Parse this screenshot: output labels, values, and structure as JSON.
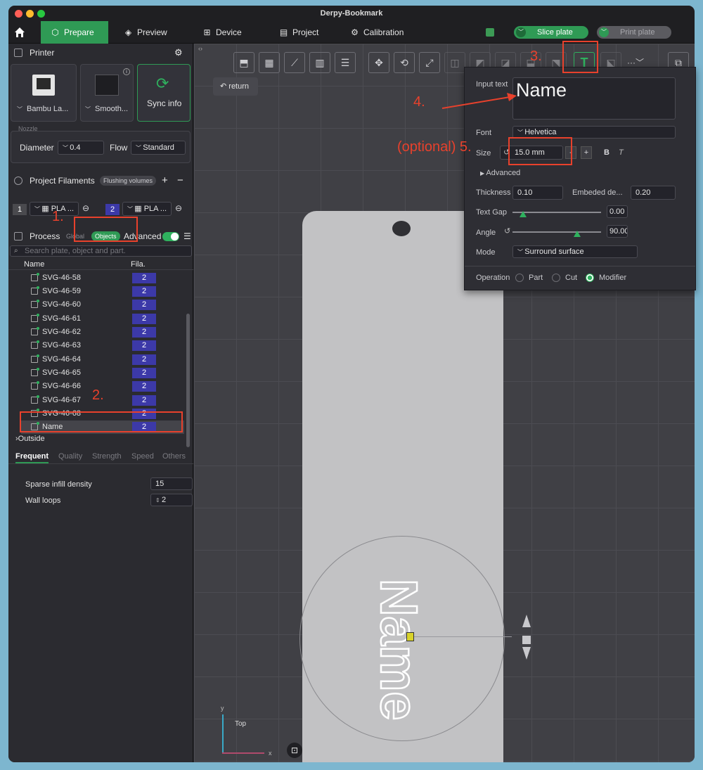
{
  "window": {
    "title": "Derpy-Bookmark"
  },
  "tabs": [
    {
      "label": "Prepare",
      "icon": "box-icon"
    },
    {
      "label": "Preview",
      "icon": "layers-icon"
    },
    {
      "label": "Device",
      "icon": "device-icon"
    },
    {
      "label": "Project",
      "icon": "project-icon"
    },
    {
      "label": "Calibration",
      "icon": "calibration-icon"
    }
  ],
  "actions": {
    "slice": "Slice plate",
    "print": "Print plate"
  },
  "printer": {
    "title": "Printer",
    "printer_name": "Bambu La...",
    "plate": "Smooth...",
    "sync": "Sync info",
    "nozzle_label": "Nozzle",
    "diameter_label": "Diameter",
    "diameter": "0.4",
    "flow_label": "Flow",
    "flow": "Standard"
  },
  "filaments": {
    "title": "Project Filaments",
    "flushing": "Flushing volumes",
    "items": [
      {
        "num": "1",
        "name": "PLA ...",
        "color": "#4a4a4e"
      },
      {
        "num": "2",
        "name": "PLA ...",
        "color": "#3c39a8"
      }
    ]
  },
  "process": {
    "title": "Process",
    "global": "Global",
    "objects": "Objects",
    "advanced": "Advanced",
    "search_placeholder": "Search plate, object and part.",
    "col_name": "Name",
    "col_fila": "Fila.",
    "rows": [
      {
        "name": "SVG-46-58",
        "fila": "2"
      },
      {
        "name": "SVG-46-59",
        "fila": "2"
      },
      {
        "name": "SVG-46-60",
        "fila": "2"
      },
      {
        "name": "SVG-46-61",
        "fila": "2"
      },
      {
        "name": "SVG-46-62",
        "fila": "2"
      },
      {
        "name": "SVG-46-63",
        "fila": "2"
      },
      {
        "name": "SVG-46-64",
        "fila": "2"
      },
      {
        "name": "SVG-46-65",
        "fila": "2"
      },
      {
        "name": "SVG-46-66",
        "fila": "2"
      },
      {
        "name": "SVG-46-67",
        "fila": "2"
      },
      {
        "name": "SVG-46-68",
        "fila": "2"
      },
      {
        "name": "Name",
        "fila": "2"
      }
    ],
    "outside": "Outside",
    "subtabs": [
      "Frequent",
      "Quality",
      "Strength",
      "Speed",
      "Others"
    ],
    "settings": [
      {
        "label": "Sparse infill density",
        "value": "15"
      },
      {
        "label": "Wall loops",
        "value": "2"
      }
    ]
  },
  "viewport": {
    "return": "return",
    "axes_view": "Top",
    "axis_x": "x",
    "axis_y": "y",
    "model_text": "Name"
  },
  "text_panel": {
    "input_label": "Input text",
    "input_value": "Name",
    "font_label": "Font",
    "font_value": "Helvetica",
    "size_label": "Size",
    "size_value": "15.0 mm",
    "minus": "-",
    "plus": "+",
    "bold": "B",
    "italic": "T",
    "advanced": "Advanced",
    "thickness_label": "Thickness",
    "thickness": "0.10",
    "embedded_label": "Embeded de...",
    "embedded": "0.20",
    "gap_label": "Text Gap",
    "gap": "0.00",
    "angle_label": "Angle",
    "angle": "90.00",
    "mode_label": "Mode",
    "mode": "Surround surface",
    "operation_label": "Operation",
    "op_part": "Part",
    "op_cut": "Cut",
    "op_modifier": "Modifier"
  },
  "annotations": {
    "a1": "1.",
    "a2": "2.",
    "a3": "3.",
    "a4": "4.",
    "a5": "(optional) 5."
  },
  "colors": {
    "accent": "#2f9a55",
    "annotation": "#e8412c",
    "filament2": "#3c39a8"
  }
}
